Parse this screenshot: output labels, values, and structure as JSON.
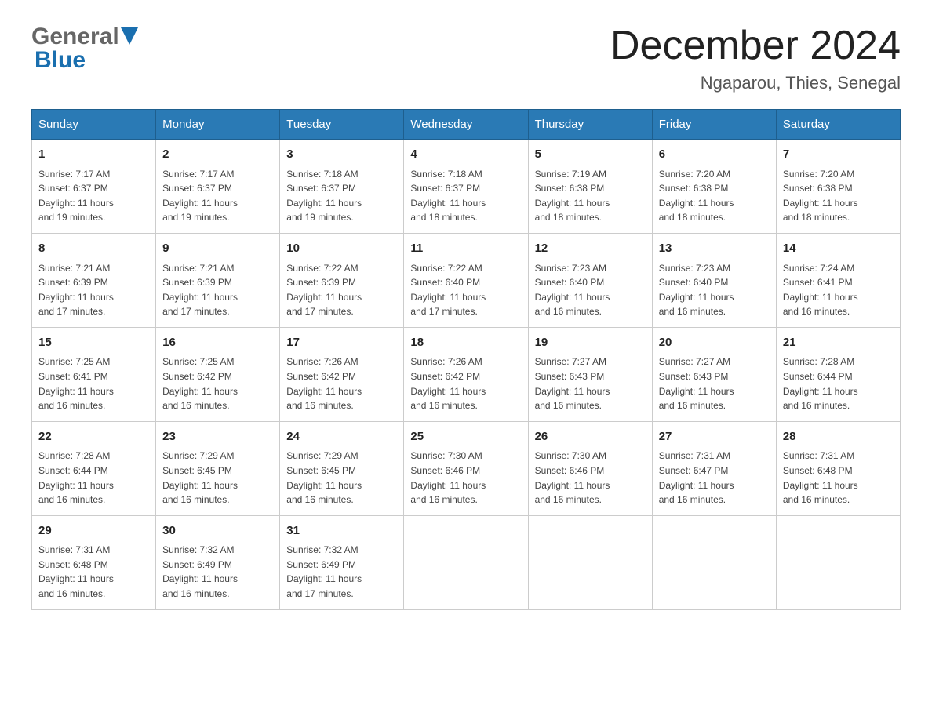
{
  "logo": {
    "general": "General",
    "blue": "Blue"
  },
  "header": {
    "title": "December 2024",
    "subtitle": "Ngaparou, Thies, Senegal"
  },
  "days_of_week": [
    "Sunday",
    "Monday",
    "Tuesday",
    "Wednesday",
    "Thursday",
    "Friday",
    "Saturday"
  ],
  "weeks": [
    [
      {
        "day": "1",
        "sunrise": "7:17 AM",
        "sunset": "6:37 PM",
        "daylight": "11 hours and 19 minutes."
      },
      {
        "day": "2",
        "sunrise": "7:17 AM",
        "sunset": "6:37 PM",
        "daylight": "11 hours and 19 minutes."
      },
      {
        "day": "3",
        "sunrise": "7:18 AM",
        "sunset": "6:37 PM",
        "daylight": "11 hours and 19 minutes."
      },
      {
        "day": "4",
        "sunrise": "7:18 AM",
        "sunset": "6:37 PM",
        "daylight": "11 hours and 18 minutes."
      },
      {
        "day": "5",
        "sunrise": "7:19 AM",
        "sunset": "6:38 PM",
        "daylight": "11 hours and 18 minutes."
      },
      {
        "day": "6",
        "sunrise": "7:20 AM",
        "sunset": "6:38 PM",
        "daylight": "11 hours and 18 minutes."
      },
      {
        "day": "7",
        "sunrise": "7:20 AM",
        "sunset": "6:38 PM",
        "daylight": "11 hours and 18 minutes."
      }
    ],
    [
      {
        "day": "8",
        "sunrise": "7:21 AM",
        "sunset": "6:39 PM",
        "daylight": "11 hours and 17 minutes."
      },
      {
        "day": "9",
        "sunrise": "7:21 AM",
        "sunset": "6:39 PM",
        "daylight": "11 hours and 17 minutes."
      },
      {
        "day": "10",
        "sunrise": "7:22 AM",
        "sunset": "6:39 PM",
        "daylight": "11 hours and 17 minutes."
      },
      {
        "day": "11",
        "sunrise": "7:22 AM",
        "sunset": "6:40 PM",
        "daylight": "11 hours and 17 minutes."
      },
      {
        "day": "12",
        "sunrise": "7:23 AM",
        "sunset": "6:40 PM",
        "daylight": "11 hours and 16 minutes."
      },
      {
        "day": "13",
        "sunrise": "7:23 AM",
        "sunset": "6:40 PM",
        "daylight": "11 hours and 16 minutes."
      },
      {
        "day": "14",
        "sunrise": "7:24 AM",
        "sunset": "6:41 PM",
        "daylight": "11 hours and 16 minutes."
      }
    ],
    [
      {
        "day": "15",
        "sunrise": "7:25 AM",
        "sunset": "6:41 PM",
        "daylight": "11 hours and 16 minutes."
      },
      {
        "day": "16",
        "sunrise": "7:25 AM",
        "sunset": "6:42 PM",
        "daylight": "11 hours and 16 minutes."
      },
      {
        "day": "17",
        "sunrise": "7:26 AM",
        "sunset": "6:42 PM",
        "daylight": "11 hours and 16 minutes."
      },
      {
        "day": "18",
        "sunrise": "7:26 AM",
        "sunset": "6:42 PM",
        "daylight": "11 hours and 16 minutes."
      },
      {
        "day": "19",
        "sunrise": "7:27 AM",
        "sunset": "6:43 PM",
        "daylight": "11 hours and 16 minutes."
      },
      {
        "day": "20",
        "sunrise": "7:27 AM",
        "sunset": "6:43 PM",
        "daylight": "11 hours and 16 minutes."
      },
      {
        "day": "21",
        "sunrise": "7:28 AM",
        "sunset": "6:44 PM",
        "daylight": "11 hours and 16 minutes."
      }
    ],
    [
      {
        "day": "22",
        "sunrise": "7:28 AM",
        "sunset": "6:44 PM",
        "daylight": "11 hours and 16 minutes."
      },
      {
        "day": "23",
        "sunrise": "7:29 AM",
        "sunset": "6:45 PM",
        "daylight": "11 hours and 16 minutes."
      },
      {
        "day": "24",
        "sunrise": "7:29 AM",
        "sunset": "6:45 PM",
        "daylight": "11 hours and 16 minutes."
      },
      {
        "day": "25",
        "sunrise": "7:30 AM",
        "sunset": "6:46 PM",
        "daylight": "11 hours and 16 minutes."
      },
      {
        "day": "26",
        "sunrise": "7:30 AM",
        "sunset": "6:46 PM",
        "daylight": "11 hours and 16 minutes."
      },
      {
        "day": "27",
        "sunrise": "7:31 AM",
        "sunset": "6:47 PM",
        "daylight": "11 hours and 16 minutes."
      },
      {
        "day": "28",
        "sunrise": "7:31 AM",
        "sunset": "6:48 PM",
        "daylight": "11 hours and 16 minutes."
      }
    ],
    [
      {
        "day": "29",
        "sunrise": "7:31 AM",
        "sunset": "6:48 PM",
        "daylight": "11 hours and 16 minutes."
      },
      {
        "day": "30",
        "sunrise": "7:32 AM",
        "sunset": "6:49 PM",
        "daylight": "11 hours and 16 minutes."
      },
      {
        "day": "31",
        "sunrise": "7:32 AM",
        "sunset": "6:49 PM",
        "daylight": "11 hours and 17 minutes."
      },
      null,
      null,
      null,
      null
    ]
  ],
  "labels": {
    "sunrise": "Sunrise:",
    "sunset": "Sunset:",
    "daylight": "Daylight:"
  }
}
